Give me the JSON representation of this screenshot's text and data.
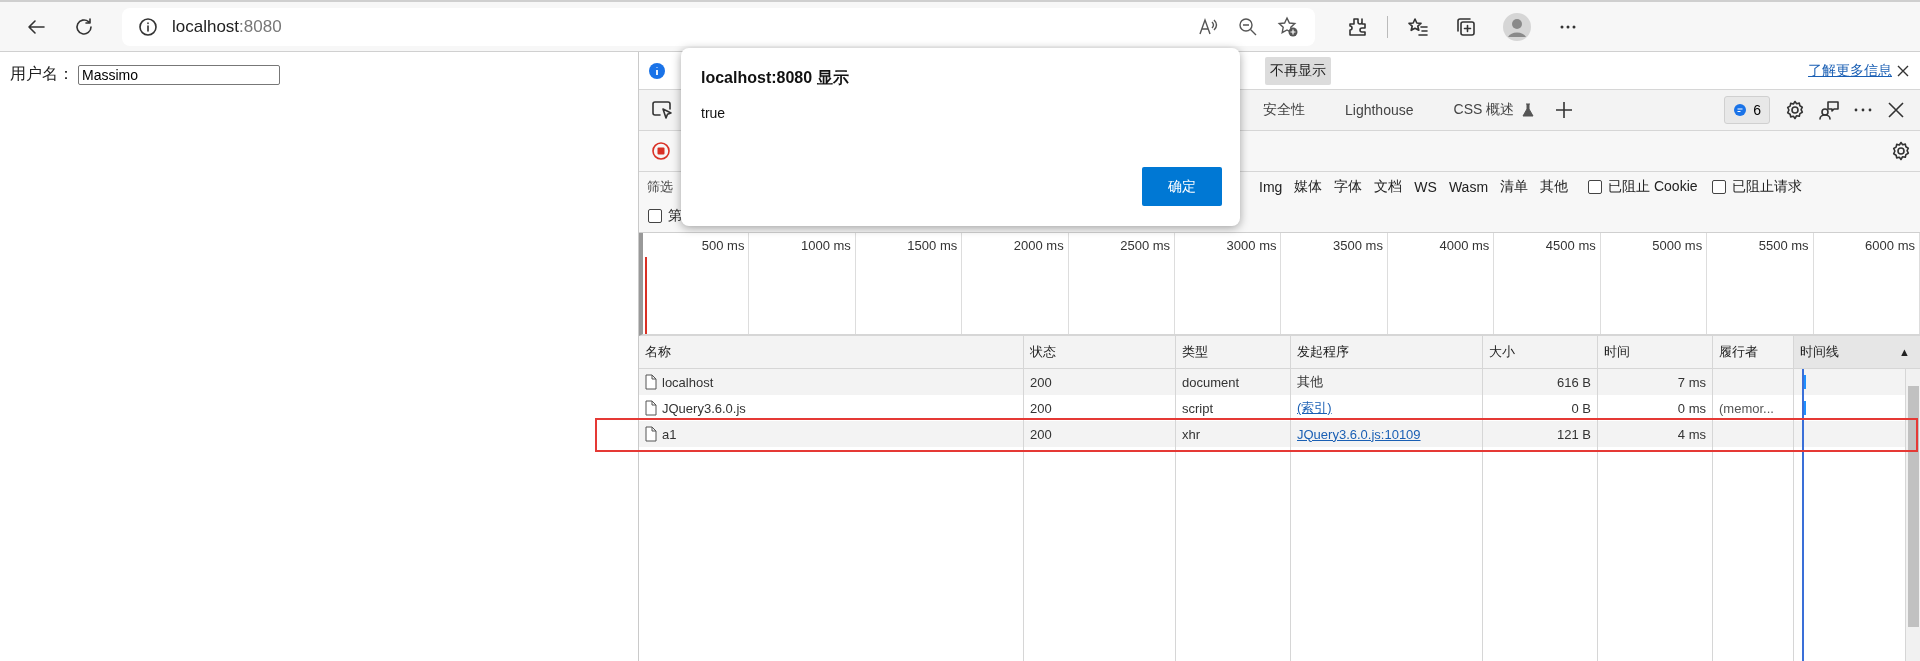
{
  "browser": {
    "address_host": "localhost",
    "address_port": ":8080"
  },
  "page": {
    "label": "用户名：",
    "input_value": "Massimo"
  },
  "devtools": {
    "infobar": {
      "button": "不再显示",
      "link": "了解更多信息"
    },
    "tabs": [
      {
        "label": "安全性",
        "selected": false,
        "experimental": false
      },
      {
        "label": "Lighthouse",
        "selected": false,
        "experimental": false
      },
      {
        "label": "CSS 概述",
        "selected": false,
        "experimental": true
      }
    ],
    "issues_count": "6",
    "recording": true,
    "filter": {
      "label": "筛选",
      "types": [
        {
          "label": "Img",
          "selected": false
        },
        {
          "label": "媒体",
          "selected": false
        },
        {
          "label": "字体",
          "selected": false
        },
        {
          "label": "文档",
          "selected": false
        },
        {
          "label": "WS",
          "selected": false
        },
        {
          "label": "Wasm",
          "selected": false
        },
        {
          "label": "清单",
          "selected": false
        },
        {
          "label": "其他",
          "selected": false
        }
      ],
      "checkboxes": [
        {
          "label": "已阻止 Cookie",
          "checked": false
        },
        {
          "label": "已阻止请求",
          "checked": false
        }
      ],
      "second_row_checkbox": {
        "label": "第",
        "checked": false
      }
    },
    "overview": {
      "ticks": [
        "500 ms",
        "1000 ms",
        "1500 ms",
        "2000 ms",
        "2500 ms",
        "3000 ms",
        "3500 ms",
        "4000 ms",
        "4500 ms",
        "5000 ms",
        "5500 ms",
        "6000 ms"
      ]
    },
    "table": {
      "columns": [
        {
          "label": "名称"
        },
        {
          "label": "状态"
        },
        {
          "label": "类型"
        },
        {
          "label": "发起程序"
        },
        {
          "label": "大小"
        },
        {
          "label": "时间"
        },
        {
          "label": "履行者"
        },
        {
          "label": "时间线",
          "sort_indicator": "▲"
        }
      ],
      "rows": [
        {
          "name": "localhost",
          "status": "200",
          "type": "document",
          "initiator": "其他",
          "initiator_link": false,
          "size": "616 B",
          "time": "7 ms",
          "waterfall_bar": true,
          "highlighted": false
        },
        {
          "name": "JQuery3.6.0.js",
          "status": "200",
          "type": "script",
          "initiator": "(索引)",
          "initiator_link": true,
          "size": "0 B",
          "time": "0 ms",
          "fulfilled_by": "(memor...",
          "waterfall_bar": true,
          "highlighted": false
        },
        {
          "name": "a1",
          "status": "200",
          "type": "xhr",
          "initiator": "JQuery3.6.0.js:10109",
          "initiator_link": true,
          "size": "121 B",
          "time": "4 ms",
          "waterfall_bar": false,
          "highlighted": true
        }
      ]
    }
  },
  "dialog": {
    "title": "localhost:8080 显示",
    "message": "true",
    "button": "确定"
  }
}
